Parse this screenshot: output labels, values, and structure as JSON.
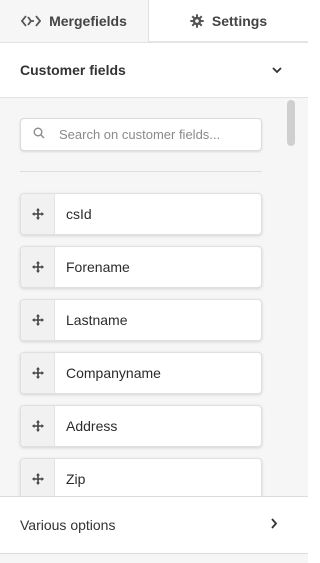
{
  "tabs": {
    "mergefields": {
      "label": "Mergefields",
      "icon": "code-icon"
    },
    "settings": {
      "label": "Settings",
      "icon": "gear-icon"
    }
  },
  "customer_fields": {
    "title": "Customer fields",
    "toggle_icon": "chevron-down-icon",
    "search": {
      "placeholder": "Search on customer fields...",
      "value": ""
    },
    "items": [
      {
        "label": "csId"
      },
      {
        "label": "Forename"
      },
      {
        "label": "Lastname"
      },
      {
        "label": "Companyname"
      },
      {
        "label": "Address"
      },
      {
        "label": "Zip"
      }
    ]
  },
  "various_options": {
    "title": "Various options",
    "toggle_icon": "chevron-right-icon"
  },
  "colors": {
    "panel_bg": "#f6f6f6",
    "text": "#2b2b2b",
    "border": "#e0e0e0"
  }
}
